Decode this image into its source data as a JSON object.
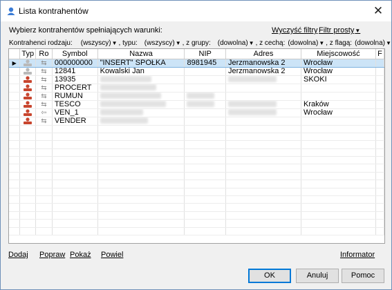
{
  "window": {
    "title": "Lista kontrahentów",
    "close_glyph": "✕"
  },
  "conditions": {
    "label": "Wybierz kontrahentów spełniających warunki:",
    "clear_filters": "Wyczyść filtry",
    "simple_filter": "Filtr prosty"
  },
  "filters": {
    "kind_label": "Kontrahenci rodzaju:",
    "kind_value": "(wszyscy)",
    "type_label": ", typu:",
    "type_value": "(wszyscy)",
    "group_label": ", z grupy:",
    "group_value": "(dowolna)",
    "feature_label": ", z cechą:",
    "feature_value": "(dowolna)",
    "flag_label": ", z flagą:",
    "flag_value": "(dowolna)"
  },
  "grid": {
    "columns": [
      "Typ",
      "Ro",
      "Symbol",
      "Nazwa",
      "NIP",
      "Adres",
      "Miejscowość",
      "F"
    ],
    "rows": [
      {
        "selected": true,
        "typ_icon": "person-icon-grey",
        "ro": "⇆",
        "symbol": "000000000",
        "nazwa": "\"INSERT\" SPÓŁKA",
        "nip": "8981945",
        "adres": "Jerzmanowska 2",
        "miejscowosc": "Wrocław"
      },
      {
        "selected": false,
        "typ_icon": "person-icon-grey",
        "ro": "⇆",
        "symbol": "12841",
        "nazwa": "Kowalski Jan",
        "nip": "",
        "adres": "Jerzmanowska 2",
        "miejscowosc": "Wrocław"
      },
      {
        "selected": false,
        "typ_icon": "person-icon-red",
        "ro": "⇆",
        "symbol": "13935",
        "nazwa": "",
        "nip": "",
        "adres": "",
        "miejscowosc": "SKOKI"
      },
      {
        "selected": false,
        "typ_icon": "person-icon-red",
        "ro": "⇆",
        "symbol": "PROCERT",
        "nazwa": "",
        "nip": "",
        "adres": "",
        "miejscowosc": ""
      },
      {
        "selected": false,
        "typ_icon": "person-icon-red",
        "ro": "⇆",
        "symbol": "RUMUN",
        "nazwa": "",
        "nip": "",
        "adres": "",
        "miejscowosc": ""
      },
      {
        "selected": false,
        "typ_icon": "person-icon-red",
        "ro": "⇆",
        "symbol": "TESCO",
        "nazwa": "",
        "nip": "",
        "adres": "",
        "miejscowosc": "Kraków"
      },
      {
        "selected": false,
        "typ_icon": "person-icon-red",
        "ro": "⇦",
        "symbol": "VEN_1",
        "nazwa": "",
        "nip": "",
        "adres": "",
        "miejscowosc": "Wrocław"
      },
      {
        "selected": false,
        "typ_icon": "person-icon-red",
        "ro": "⇆",
        "symbol": "VENDER",
        "nazwa": "",
        "nip": "",
        "adres": "",
        "miejscowosc": ""
      }
    ],
    "row_indicator": "▶"
  },
  "actions": {
    "add": "Dodaj",
    "edit": "Popraw",
    "show": "Pokaż",
    "copy": "Powiel",
    "informer": "Informator"
  },
  "buttons": {
    "ok": "OK",
    "cancel": "Anuluj",
    "help": "Pomoc"
  },
  "colors": {
    "selection": "#cce4f7",
    "selection_border": "#7cb1df",
    "default_button_border": "#0078d7"
  }
}
